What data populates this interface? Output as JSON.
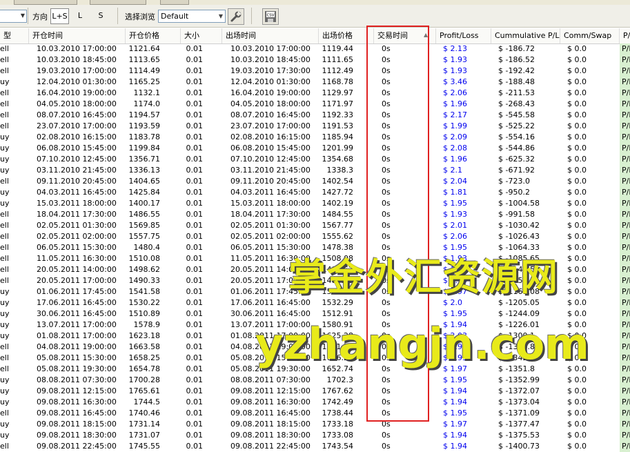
{
  "toolbar": {
    "direction_label": "方向",
    "dir_ls": "L+S",
    "dir_l": "L",
    "dir_s": "S",
    "browse_label": "选择浏览",
    "browse_value": "Default",
    "wrench_icon": "wrench-icon",
    "csv_icon": "csv-export-icon",
    "csv_text": "CSV"
  },
  "columns": [
    "型",
    "开仓时间",
    "开仓价格",
    "大小",
    "出场时间",
    "出场价格",
    "交易时间",
    "Profit/Loss",
    "Cummulative P/L",
    "Comm/Swap",
    "P/L"
  ],
  "rows": [
    [
      "ell",
      "10.03.2010 17:00:00",
      "1121.64",
      "0.01",
      "10.03.2010 17:00:00",
      "1119.44",
      "0s",
      "$ 2.13",
      "$ -186.72",
      "$ 0.0",
      "P/L"
    ],
    [
      "ell",
      "10.03.2010 18:45:00",
      "1113.65",
      "0.01",
      "10.03.2010 18:45:00",
      "1111.65",
      "0s",
      "$ 1.93",
      "$ -186.52",
      "$ 0.0",
      "P/L"
    ],
    [
      "ell",
      "19.03.2010 17:00:00",
      "1114.49",
      "0.01",
      "19.03.2010 17:30:00",
      "1112.49",
      "0s",
      "$ 1.93",
      "$ -192.42",
      "$ 0.0",
      "P/L"
    ],
    [
      "uy",
      "12.04.2010 01:30:00",
      "1165.25",
      "0.01",
      "12.04.2010 01:30:00",
      "1168.78",
      "0s",
      "$ 3.46",
      "$ -188.48",
      "$ 0.0",
      "P/L"
    ],
    [
      "ell",
      "16.04.2010 19:00:00",
      "1132.1",
      "0.01",
      "16.04.2010 19:00:00",
      "1129.97",
      "0s",
      "$ 2.06",
      "$ -211.53",
      "$ 0.0",
      "P/L"
    ],
    [
      "ell",
      "04.05.2010 18:00:00",
      "1174.0",
      "0.01",
      "04.05.2010 18:00:00",
      "1171.97",
      "0s",
      "$ 1.96",
      "$ -268.43",
      "$ 0.0",
      "P/L"
    ],
    [
      "ell",
      "08.07.2010 16:45:00",
      "1194.57",
      "0.01",
      "08.07.2010 16:45:00",
      "1192.33",
      "0s",
      "$ 2.17",
      "$ -545.58",
      "$ 0.0",
      "P/L"
    ],
    [
      "ell",
      "23.07.2010 17:00:00",
      "1193.59",
      "0.01",
      "23.07.2010 17:00:00",
      "1191.53",
      "0s",
      "$ 1.99",
      "$ -525.22",
      "$ 0.0",
      "P/L"
    ],
    [
      "uy",
      "02.08.2010 16:15:00",
      "1183.78",
      "0.01",
      "02.08.2010 16:15:00",
      "1185.94",
      "0s",
      "$ 2.09",
      "$ -554.16",
      "$ 0.0",
      "P/L"
    ],
    [
      "uy",
      "06.08.2010 15:45:00",
      "1199.84",
      "0.01",
      "06.08.2010 15:45:00",
      "1201.99",
      "0s",
      "$ 2.08",
      "$ -544.86",
      "$ 0.0",
      "P/L"
    ],
    [
      "uy",
      "07.10.2010 12:45:00",
      "1356.71",
      "0.01",
      "07.10.2010 12:45:00",
      "1354.68",
      "0s",
      "$ 1.96",
      "$ -625.32",
      "$ 0.0",
      "P/L"
    ],
    [
      "uy",
      "03.11.2010 21:45:00",
      "1336.13",
      "0.01",
      "03.11.2010 21:45:00",
      "1338.3",
      "0s",
      "$ 2.1",
      "$ -671.92",
      "$ 0.0",
      "P/L"
    ],
    [
      "ell",
      "09.11.2010 20:45:00",
      "1404.65",
      "0.01",
      "09.11.2010 20:45:00",
      "1402.54",
      "0s",
      "$ 2.04",
      "$ -723.0",
      "$ 0.0",
      "P/L"
    ],
    [
      "uy",
      "04.03.2011 16:45:00",
      "1425.84",
      "0.01",
      "04.03.2011 16:45:00",
      "1427.72",
      "0s",
      "$ 1.81",
      "$ -950.2",
      "$ 0.0",
      "P/L"
    ],
    [
      "uy",
      "15.03.2011 18:00:00",
      "1400.17",
      "0.01",
      "15.03.2011 18:00:00",
      "1402.19",
      "0s",
      "$ 1.95",
      "$ -1004.58",
      "$ 0.0",
      "P/L"
    ],
    [
      "ell",
      "18.04.2011 17:30:00",
      "1486.55",
      "0.01",
      "18.04.2011 17:30:00",
      "1484.55",
      "0s",
      "$ 1.93",
      "$ -991.58",
      "$ 0.0",
      "P/L"
    ],
    [
      "ell",
      "02.05.2011 01:30:00",
      "1569.85",
      "0.01",
      "02.05.2011 01:30:00",
      "1567.77",
      "0s",
      "$ 2.01",
      "$ -1030.42",
      "$ 0.0",
      "P/L"
    ],
    [
      "ell",
      "02.05.2011 02:00:00",
      "1557.75",
      "0.01",
      "02.05.2011 02:00:00",
      "1555.62",
      "0s",
      "$ 2.06",
      "$ -1026.43",
      "$ 0.0",
      "P/L"
    ],
    [
      "ell",
      "06.05.2011 15:30:00",
      "1480.4",
      "0.01",
      "06.05.2011 15:30:00",
      "1478.38",
      "0s",
      "$ 1.95",
      "$ -1064.33",
      "$ 0.0",
      "P/L"
    ],
    [
      "ell",
      "11.05.2011 16:30:00",
      "1510.08",
      "0.01",
      "11.05.2011 16:30:00",
      "1508.08",
      "0s",
      "$ 1.93",
      "$ -1085.65",
      "$ 0.0",
      "P/L"
    ],
    [
      "ell",
      "20.05.2011 14:00:00",
      "1498.62",
      "0.01",
      "20.05.2011 14:00:00",
      "1496.62",
      "0s",
      "$ 1.93",
      "$ -1147.59",
      "$ 0.0",
      "P/L"
    ],
    [
      "ell",
      "20.05.2011 17:00:00",
      "1490.33",
      "0.01",
      "20.05.2011 17:00:00",
      "1488.33",
      "0s",
      "$ 1.93",
      "$ -1152.05",
      "$ 0.0",
      "P/L"
    ],
    [
      "uy",
      "01.06.2011 17:45:00",
      "1541.58",
      "0.01",
      "01.06.2011 17:45:00",
      "1543.62",
      "0s",
      "$ 1.97",
      "$ -1165.08",
      "$ 0.0",
      "P/L"
    ],
    [
      "uy",
      "17.06.2011 16:45:00",
      "1530.22",
      "0.01",
      "17.06.2011 16:45:00",
      "1532.29",
      "0s",
      "$ 2.0",
      "$ -1205.05",
      "$ 0.0",
      "P/L"
    ],
    [
      "uy",
      "30.06.2011 16:45:00",
      "1510.89",
      "0.01",
      "30.06.2011 16:45:00",
      "1512.91",
      "0s",
      "$ 1.95",
      "$ -1244.09",
      "$ 0.0",
      "P/L"
    ],
    [
      "uy",
      "13.07.2011 17:00:00",
      "1578.9",
      "0.01",
      "13.07.2011 17:00:00",
      "1580.91",
      "0s",
      "$ 1.94",
      "$ -1226.01",
      "$ 0.0",
      "P/L"
    ],
    [
      "uy",
      "01.08.2011 17:00:00",
      "1623.18",
      "0.01",
      "01.08.2011 17:00:00",
      "1625.28",
      "0s",
      "$ 2.03",
      "$ -1300.1",
      "$ 0.0",
      "P/L"
    ],
    [
      "ell",
      "04.08.2011 19:00:00",
      "1663.58",
      "0.01",
      "04.08.2011 19:00:00",
      "1661.55",
      "0s",
      "$ 1.96",
      "$ -1336.81",
      "$ 0.0",
      "P/L"
    ],
    [
      "ell",
      "05.08.2011 15:30:00",
      "1658.25",
      "0.01",
      "05.08.2011 15:30:00",
      "1656.25",
      "0s",
      "$ 1.93",
      "$ -1342.88",
      "$ 0.0",
      "P/L"
    ],
    [
      "ell",
      "05.08.2011 19:30:00",
      "1654.78",
      "0.01",
      "05.08.2011 19:30:00",
      "1652.74",
      "0s",
      "$ 1.97",
      "$ -1351.8",
      "$ 0.0",
      "P/L"
    ],
    [
      "uy",
      "08.08.2011 07:30:00",
      "1700.28",
      "0.01",
      "08.08.2011 07:30:00",
      "1702.3",
      "0s",
      "$ 1.95",
      "$ -1352.99",
      "$ 0.0",
      "P/L"
    ],
    [
      "uy",
      "09.08.2011 12:15:00",
      "1765.61",
      "0.01",
      "09.08.2011 12:15:00",
      "1767.62",
      "0s",
      "$ 1.94",
      "$ -1372.07",
      "$ 0.0",
      "P/L"
    ],
    [
      "uy",
      "09.08.2011 16:30:00",
      "1744.5",
      "0.01",
      "09.08.2011 16:30:00",
      "1742.49",
      "0s",
      "$ 1.94",
      "$ -1373.04",
      "$ 0.0",
      "P/L"
    ],
    [
      "ell",
      "09.08.2011 16:45:00",
      "1740.46",
      "0.01",
      "09.08.2011 16:45:00",
      "1738.44",
      "0s",
      "$ 1.95",
      "$ -1371.09",
      "$ 0.0",
      "P/L"
    ],
    [
      "uy",
      "09.08.2011 18:15:00",
      "1731.14",
      "0.01",
      "09.08.2011 18:15:00",
      "1733.18",
      "0s",
      "$ 1.97",
      "$ -1377.47",
      "$ 0.0",
      "P/L"
    ],
    [
      "uy",
      "09.08.2011 18:30:00",
      "1731.07",
      "0.01",
      "09.08.2011 18:30:00",
      "1733.08",
      "0s",
      "$ 1.94",
      "$ -1375.53",
      "$ 0.0",
      "P/L"
    ],
    [
      "ell",
      "09.08.2011 22:45:00",
      "1745.55",
      "0.01",
      "09.08.2011 22:45:00",
      "1743.54",
      "0s",
      "$ 1.94",
      "$ -1400.73",
      "$ 0.0",
      "P/L"
    ]
  ],
  "watermark": {
    "line1": "掌金外汇资源网",
    "line2": "yzhangjn.com",
    "color": "#e8ea1a"
  },
  "highlight_color": "#e02020"
}
